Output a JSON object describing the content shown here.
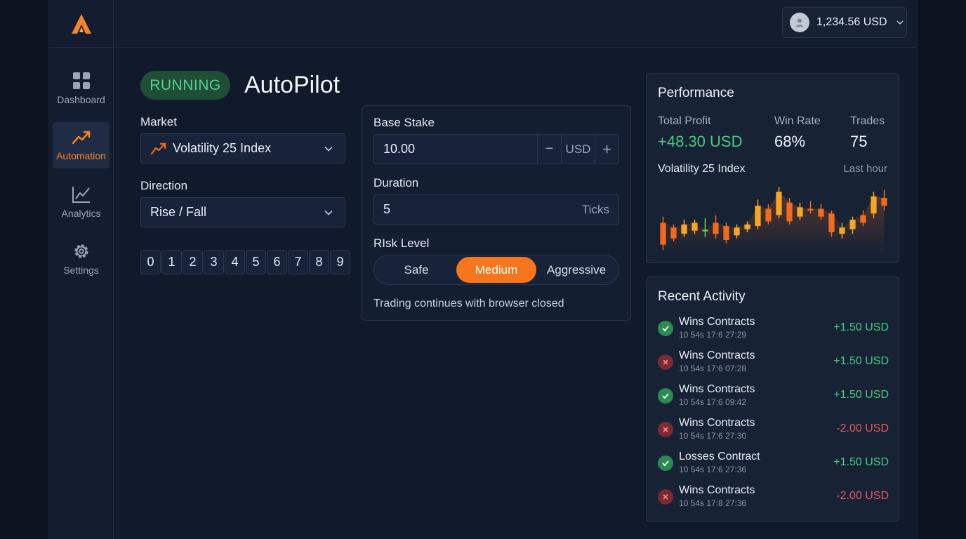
{
  "header": {
    "balance": "1,234.56 USD"
  },
  "sidebar": {
    "items": [
      {
        "label": "Dashboard",
        "icon": "grid-icon"
      },
      {
        "label": "Automation",
        "icon": "trend-up-icon",
        "active": true
      },
      {
        "label": "Analytics",
        "icon": "chart-line-icon"
      },
      {
        "label": "Settings",
        "icon": "gear-icon"
      }
    ]
  },
  "main": {
    "status": "RUNNING",
    "title": "AutoPilot",
    "market_label": "Market",
    "market_value": "Volatility 25 Index",
    "direction_label": "Direction",
    "direction_value": "Rise / Fall",
    "digits": [
      "0",
      "1",
      "2",
      "3",
      "4",
      "5",
      "6",
      "7",
      "8",
      "9"
    ]
  },
  "config": {
    "base_stake_label": "Base Stake",
    "base_stake_value": "10.00",
    "minus": "−",
    "currency": "USD",
    "plus": "+",
    "duration_label": "Duration",
    "duration_value": "5",
    "duration_unit": "Ticks",
    "risk_label": "RIsk Level",
    "risk_options": [
      "Safe",
      "Medium",
      "Aggressive"
    ],
    "risk_selected": "Medium",
    "note": "Trading continues with browser closed"
  },
  "performance": {
    "title": "Performance",
    "total_profit_label": "Total Profit",
    "total_profit_value": "+48.30 USD",
    "win_rate_label": "Win Rate",
    "win_rate_value": "68%",
    "trades_label": "Trades",
    "trades_value": "75",
    "chart_market": "Volatility 25 Index",
    "chart_range": "Last hour",
    "colors": {
      "up": "#f5a623",
      "down": "#f26a1b",
      "neutral": "#7ed957"
    }
  },
  "chart_data": {
    "type": "candlestick",
    "candles": [
      {
        "o": 40,
        "c": 12,
        "h": 48,
        "l": 5
      },
      {
        "o": 34,
        "c": 20,
        "h": 38,
        "l": 16
      },
      {
        "o": 26,
        "c": 38,
        "h": 44,
        "l": 22
      },
      {
        "o": 30,
        "c": 40,
        "h": 44,
        "l": 26
      },
      {
        "o": 30,
        "c": 31,
        "h": 46,
        "l": 22
      },
      {
        "o": 40,
        "c": 26,
        "h": 50,
        "l": 20
      },
      {
        "o": 36,
        "c": 18,
        "h": 40,
        "l": 14
      },
      {
        "o": 24,
        "c": 34,
        "h": 38,
        "l": 20
      },
      {
        "o": 32,
        "c": 38,
        "h": 42,
        "l": 28
      },
      {
        "o": 36,
        "c": 62,
        "h": 70,
        "l": 32
      },
      {
        "o": 58,
        "c": 42,
        "h": 64,
        "l": 38
      },
      {
        "o": 50,
        "c": 80,
        "h": 86,
        "l": 46
      },
      {
        "o": 66,
        "c": 42,
        "h": 72,
        "l": 38
      },
      {
        "o": 48,
        "c": 60,
        "h": 66,
        "l": 44
      },
      {
        "o": 58,
        "c": 56,
        "h": 68,
        "l": 52
      },
      {
        "o": 58,
        "c": 48,
        "h": 64,
        "l": 44
      },
      {
        "o": 52,
        "c": 28,
        "h": 56,
        "l": 22
      },
      {
        "o": 26,
        "c": 34,
        "h": 40,
        "l": 20
      },
      {
        "o": 32,
        "c": 44,
        "h": 48,
        "l": 26
      },
      {
        "o": 50,
        "c": 40,
        "h": 56,
        "l": 36
      },
      {
        "o": 52,
        "c": 74,
        "h": 80,
        "l": 46
      },
      {
        "o": 72,
        "c": 62,
        "h": 82,
        "l": 56
      }
    ]
  },
  "activity": {
    "title": "Recent Activity",
    "items": [
      {
        "title": "Wins Contracts",
        "time": "10 54s 17:6 27:29",
        "amount": "+1.50 USD",
        "result": "win",
        "positive": true
      },
      {
        "title": "Wins Contracts",
        "time": "10 54s 17:6 07:28",
        "amount": "+1.50 USD",
        "result": "loss",
        "positive": true
      },
      {
        "title": "Wins Contracts",
        "time": "10 54s 17:6 09:42",
        "amount": "+1.50 USD",
        "result": "win",
        "positive": true
      },
      {
        "title": "Wins Contracts",
        "time": "10 54s 17:6 27:30",
        "amount": "-2.00 USD",
        "result": "loss",
        "positive": false
      },
      {
        "title": "Losses Contract",
        "time": "10 54s 17:6 27:36",
        "amount": "+1.50 USD",
        "result": "win",
        "positive": true
      },
      {
        "title": "Wins Contracts",
        "time": "10 54s 17:8 27:36",
        "amount": "-2.00 USD",
        "result": "loss",
        "positive": false
      }
    ]
  }
}
